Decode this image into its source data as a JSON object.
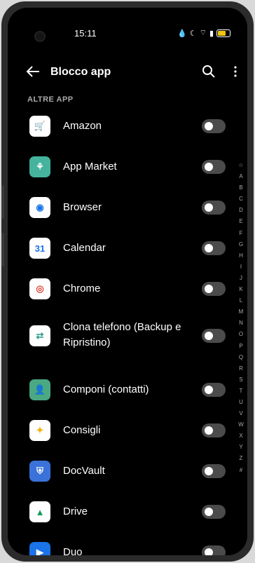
{
  "status": {
    "time": "15:11"
  },
  "appbar": {
    "title": "Blocco app"
  },
  "section_label": "ALTRE APP",
  "apps": [
    {
      "label": "Amazon",
      "icon": "amazon-icon",
      "bg": "#ffffff",
      "fg": "#1c5bb6",
      "glyph": "🛒",
      "enabled": false
    },
    {
      "label": "App Market",
      "icon": "app-market-icon",
      "bg": "#45b39d",
      "fg": "#ffffff",
      "glyph": "⚘",
      "enabled": false
    },
    {
      "label": "Browser",
      "icon": "browser-icon",
      "bg": "#ffffff",
      "fg": "#1a73e8",
      "glyph": "◉",
      "enabled": false
    },
    {
      "label": "Calendar",
      "icon": "calendar-icon",
      "bg": "#ffffff",
      "fg": "#1a73e8",
      "glyph": "31",
      "enabled": false
    },
    {
      "label": "Chrome",
      "icon": "chrome-icon",
      "bg": "#ffffff",
      "fg": "#db4437",
      "glyph": "◎",
      "enabled": false
    },
    {
      "label": "Clona telefono (Backup e Ripristino)",
      "icon": "clone-phone-icon",
      "bg": "#ffffff",
      "fg": "#2e9c8a",
      "glyph": "⇄",
      "enabled": false
    },
    {
      "label": "Componi (contatti)",
      "icon": "contacts-icon",
      "bg": "#4aa882",
      "fg": "#ffffff",
      "glyph": "👤",
      "enabled": false
    },
    {
      "label": "Consigli",
      "icon": "tips-icon",
      "bg": "#ffffff",
      "fg": "#f1b300",
      "glyph": "✦",
      "enabled": false
    },
    {
      "label": "DocVault",
      "icon": "docvault-icon",
      "bg": "#3b72d9",
      "fg": "#ffffff",
      "glyph": "⛨",
      "enabled": false
    },
    {
      "label": "Drive",
      "icon": "drive-icon",
      "bg": "#ffffff",
      "fg": "#0f9d58",
      "glyph": "▲",
      "enabled": false
    },
    {
      "label": "Duo",
      "icon": "duo-icon",
      "bg": "#1a73e8",
      "fg": "#ffffff",
      "glyph": "▶",
      "enabled": false
    }
  ],
  "alphabet": [
    "☆",
    "A",
    "B",
    "C",
    "D",
    "E",
    "F",
    "G",
    "H",
    "I",
    "J",
    "K",
    "L",
    "M",
    "N",
    "O",
    "P",
    "Q",
    "R",
    "S",
    "T",
    "U",
    "V",
    "W",
    "X",
    "Y",
    "Z",
    "#"
  ]
}
